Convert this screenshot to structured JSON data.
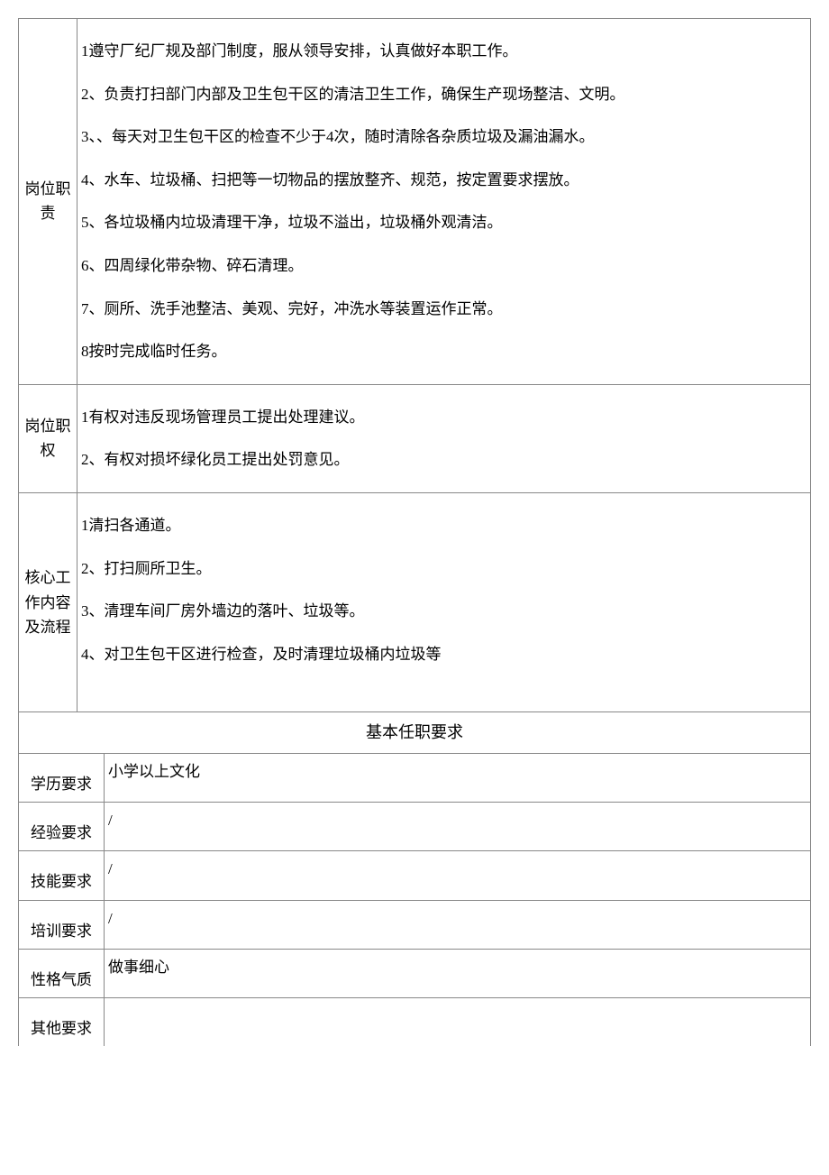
{
  "sections": {
    "duties": {
      "label": "岗位职责",
      "items": [
        "1遵守厂纪厂规及部门制度，服从领导安排，认真做好本职工作。",
        "2、负责打扫部门内部及卫生包干区的清洁卫生工作，确保生产现场整洁、文明。",
        "3、、每天对卫生包干区的检查不少于4次，随时清除各杂质垃圾及漏油漏水。",
        "4、水车、垃圾桶、扫把等一切物品的摆放整齐、规范，按定置要求摆放。",
        "5、各垃圾桶内垃圾清理干净，垃圾不溢出，垃圾桶外观清洁。",
        "6、四周绿化带杂物、碎石清理。",
        "7、厕所、洗手池整洁、美观、完好，冲洗水等装置运作正常。",
        "8按时完成临时任务。"
      ]
    },
    "authority": {
      "label": "岗位职权",
      "items": [
        "1有权对违反现场管理员工提出处理建议。",
        "2、有权对损坏绿化员工提出处罚意见。"
      ]
    },
    "workflow": {
      "label": "核心工作内容及流程",
      "items": [
        "1清扫各通道。",
        "2、打扫厕所卫生。",
        "3、清理车间厂房外墙边的落叶、垃圾等。",
        "4、对卫生包干区进行检查，及时清理垃圾桶内垃圾等"
      ]
    }
  },
  "requirements_header": "基本任职要求",
  "requirements": {
    "education": {
      "label": "学历要求",
      "value": "小学以上文化"
    },
    "experience": {
      "label": "经验要求",
      "value": "/"
    },
    "skill": {
      "label": "技能要求",
      "value": "/"
    },
    "training": {
      "label": "培训要求",
      "value": "/"
    },
    "personality": {
      "label": "性格气质",
      "value": "做事细心"
    },
    "other": {
      "label": "其他要求",
      "value": ""
    }
  }
}
